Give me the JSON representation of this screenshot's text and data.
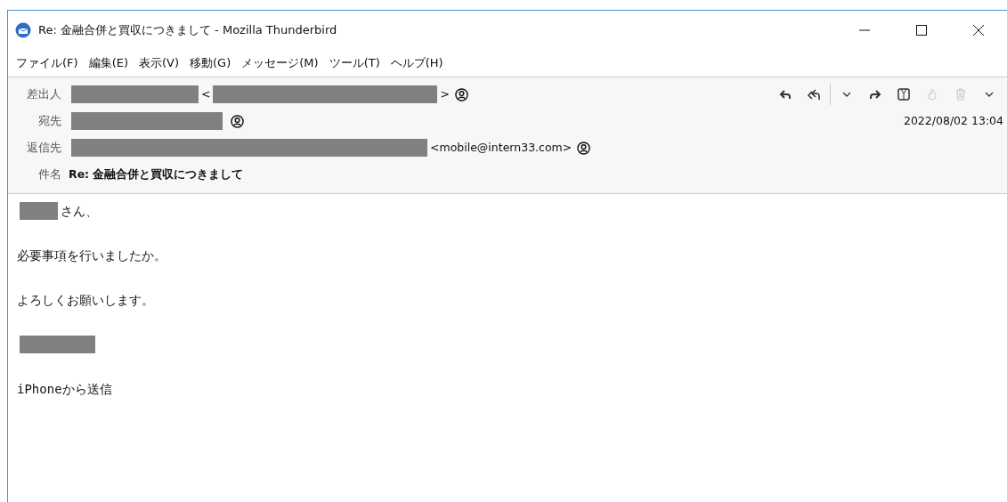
{
  "window": {
    "title": "Re: 金融合併と買収につきまして - Mozilla Thunderbird"
  },
  "menu": [
    "ファイル(F)",
    "編集(E)",
    "表示(V)",
    "移動(G)",
    "メッセージ(M)",
    "ツール(T)",
    "ヘルプ(H)"
  ],
  "toolbar": [
    {
      "kind": "reply",
      "disabled": false
    },
    {
      "kind": "reply-all",
      "disabled": false
    },
    {
      "kind": "dropdown",
      "disabled": false
    },
    {
      "kind": "forward",
      "disabled": false
    },
    {
      "kind": "archive",
      "disabled": false
    },
    {
      "kind": "junk",
      "disabled": true
    },
    {
      "kind": "delete",
      "disabled": true
    },
    {
      "kind": "more",
      "disabled": false
    }
  ],
  "headers": [
    {
      "label": "差出人",
      "segments": [
        {
          "kind": "redacted"
        },
        {
          "kind": "text",
          "text": "<"
        },
        {
          "kind": "redacted"
        },
        {
          "kind": "text",
          "text": ">"
        },
        {
          "kind": "contact"
        }
      ]
    },
    {
      "label": "宛先",
      "date": "2022/08/02 13:04",
      "segments": [
        {
          "kind": "redacted"
        },
        {
          "kind": "contact"
        }
      ]
    },
    {
      "label": "返信先",
      "segments": [
        {
          "kind": "redacted"
        },
        {
          "kind": "text",
          "text": "<mobile@intern33.com>"
        },
        {
          "kind": "contact"
        }
      ]
    },
    {
      "label": "件名",
      "subject": "Re: 金融合併と買収につきまして"
    }
  ],
  "body": [
    [
      {
        "kind": "redacted"
      },
      {
        "kind": "text",
        "text": "さん、"
      }
    ],
    [
      {
        "kind": "text",
        "text": "必要事項を行いましたか。"
      }
    ],
    [
      {
        "kind": "text",
        "text": "よろしくお願いします。"
      }
    ],
    [
      {
        "kind": "redacted"
      }
    ],
    [
      {
        "kind": "text",
        "text": "iPhoneから送信"
      }
    ]
  ]
}
